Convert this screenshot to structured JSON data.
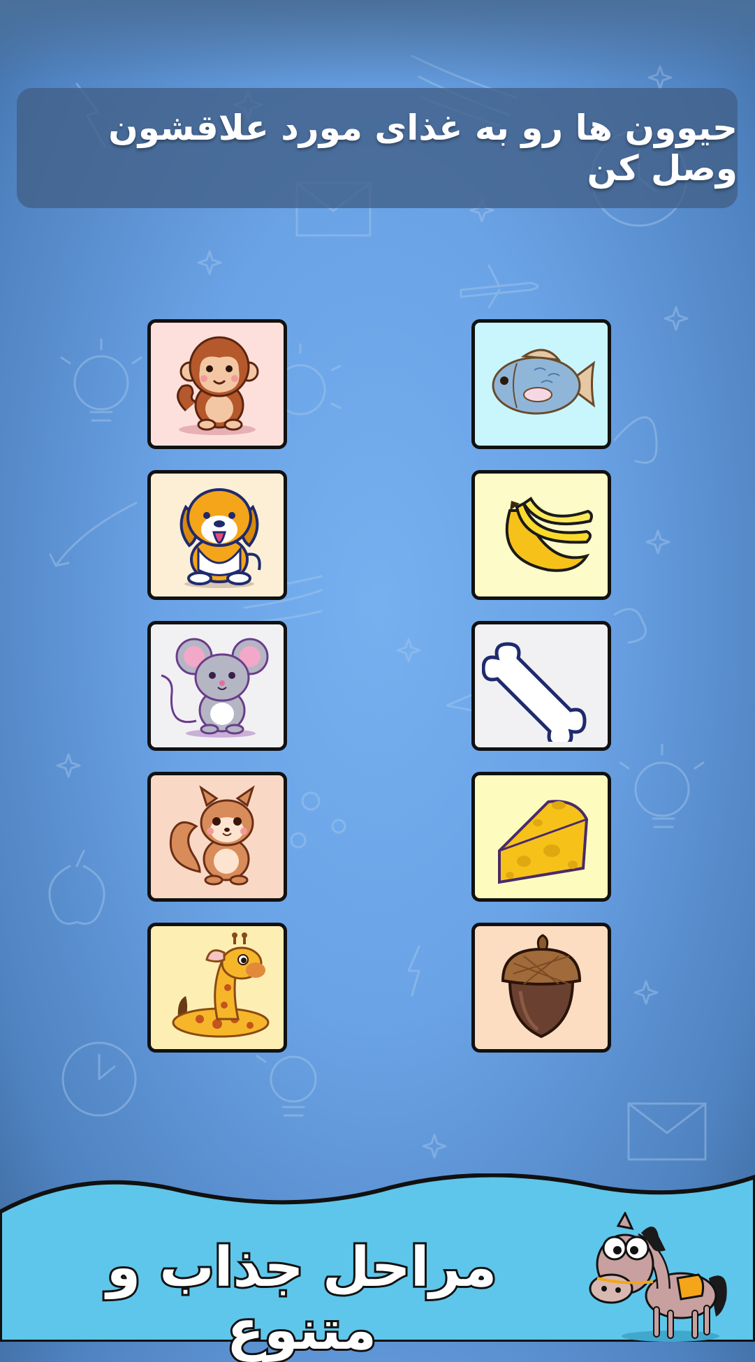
{
  "header": {
    "instruction": "حیوون ها رو به غذای مورد علاقشون وصل کن"
  },
  "cards": {
    "left": [
      {
        "name": "monkey-card",
        "icon": "monkey-icon",
        "bg": "#fde0dc"
      },
      {
        "name": "dog-card",
        "icon": "dog-icon",
        "bg": "#fdefd6"
      },
      {
        "name": "mouse-card",
        "icon": "mouse-icon",
        "bg": "#f1f1f3"
      },
      {
        "name": "squirrel-card",
        "icon": "squirrel-icon",
        "bg": "#fad8c6"
      },
      {
        "name": "giraffe-card",
        "icon": "giraffe-icon",
        "bg": "#fdefb4"
      }
    ],
    "right": [
      {
        "name": "fish-card",
        "icon": "fish-icon",
        "bg": "#c9f6fc"
      },
      {
        "name": "banana-card",
        "icon": "banana-icon",
        "bg": "#fdfbc8"
      },
      {
        "name": "bone-card",
        "icon": "bone-icon",
        "bg": "#f1f1f3"
      },
      {
        "name": "cheese-card",
        "icon": "cheese-icon",
        "bg": "#fdfbbe"
      },
      {
        "name": "acorn-card",
        "icon": "acorn-icon",
        "bg": "#fcddc2"
      }
    ]
  },
  "footer": {
    "caption": "مراحل جذاب و متنوع",
    "mascot": "donkey-icon"
  },
  "colors": {
    "wave": "#5ec6ea",
    "card_border": "#111111"
  }
}
